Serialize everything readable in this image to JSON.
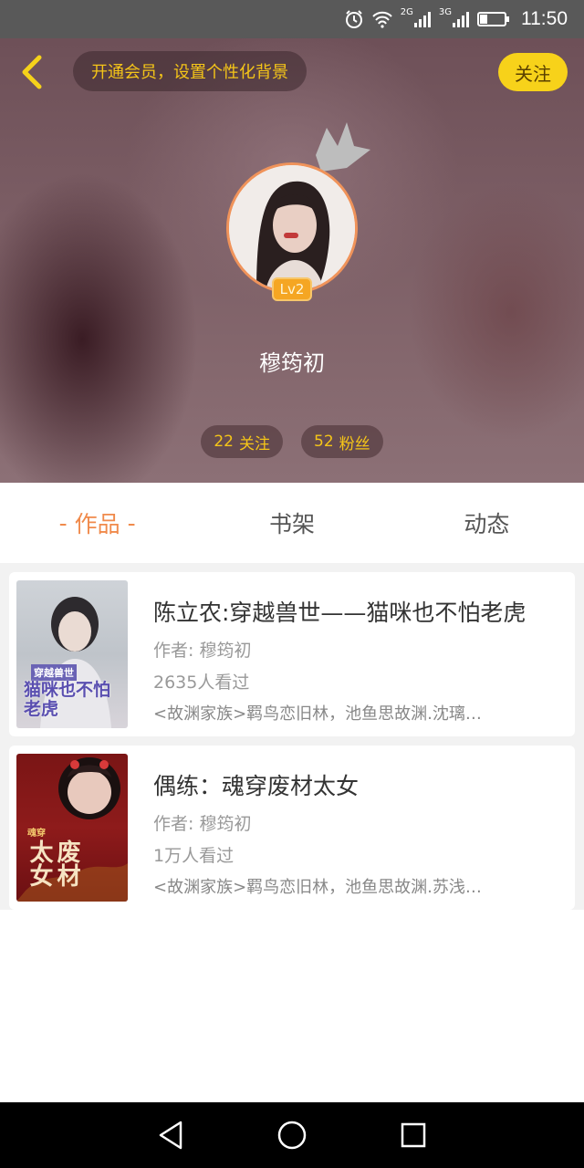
{
  "status_bar": {
    "time": "11:50",
    "signal_2g": "2G",
    "signal_3g": "3G",
    "icons": [
      "alarm-icon",
      "wifi-icon",
      "signal-icon",
      "battery-icon"
    ]
  },
  "header": {
    "vip_prompt": "开通会员，设置个性化背景",
    "follow_label": "关注",
    "level_badge": "Lv2",
    "username": "穆筠初",
    "following": {
      "count": "22",
      "label": "关注"
    },
    "followers": {
      "count": "52",
      "label": "粉丝"
    }
  },
  "tabs": {
    "items": [
      {
        "label": "作品",
        "active": true
      },
      {
        "label": "书架",
        "active": false
      },
      {
        "label": "动态",
        "active": false
      }
    ],
    "active_dash": "-"
  },
  "books": [
    {
      "title": "陈立农:穿越兽世——猫咪也不怕老虎",
      "author_label": "作者: 穆筠初",
      "views": "2635人看过",
      "desc": "<故渊家族>羁鸟恋旧林，池鱼思故渊.沈璃…",
      "cover_text": "猫咪也不怕老虎",
      "cover_sub": "穿越兽世"
    },
    {
      "title": "偶练：魂穿废材太女",
      "author_label": "作者: 穆筠初",
      "views": "1万人看过",
      "desc": "<故渊家族>羁鸟恋旧林，池鱼思故渊.苏浅…",
      "cover_text": "废材太女",
      "cover_sub": "魂穿"
    }
  ],
  "colors": {
    "accent_orange": "#f08a4b",
    "gold": "#f5c518",
    "follow_yellow": "#f7d21a"
  }
}
